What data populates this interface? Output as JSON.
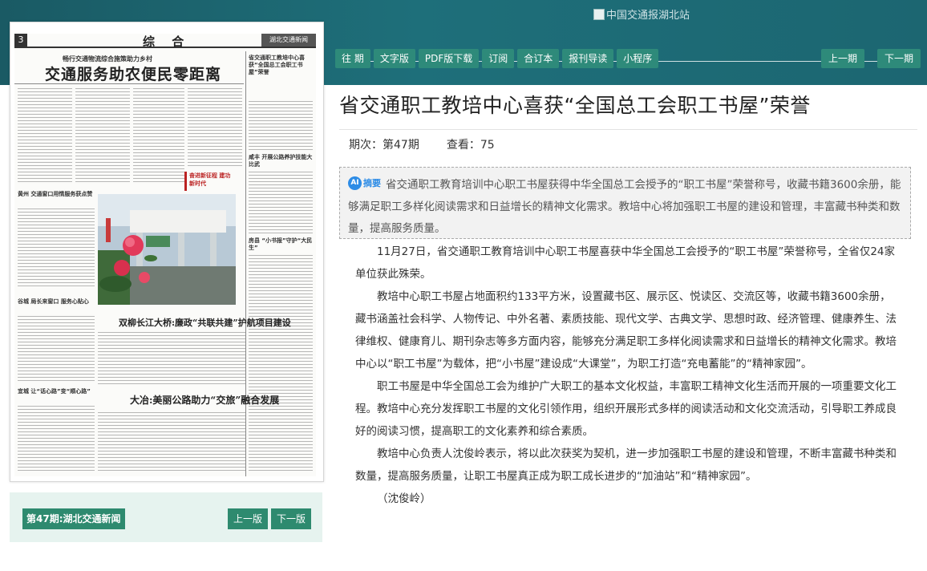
{
  "header": {
    "logo_alt": "中国交通报湖北站",
    "nav": [
      "往 期",
      "文字版",
      "PDF版下载",
      "订阅",
      "合订本",
      "报刊导读",
      "小程序"
    ],
    "prev_issue": "上一期",
    "next_issue": "下一期"
  },
  "newspaper": {
    "page_number": "3",
    "section": "综 合",
    "masthead": "湖北交通新闻",
    "headlines": {
      "kicker": "畅行交通物流综合施策助力乡村",
      "main": "交通服务助农便民零距离",
      "side_top": "省交通职工教培中心喜获“全国总工会职工书屋”荣誉",
      "photo_caption_hl": "双柳长江大桥:廉政“共联共建”护航项目建设",
      "bottom": "大冶:美丽公路助力“交旅”融合发展",
      "left1": "黄州 交通窗口用情服务获点赞",
      "left2": "谷城 局长来窗口 服务心贴心",
      "left3": "宜城 让“话心路”变“顺心路”",
      "right1": "咸丰 开展公路养护技能大比武",
      "right2": "房县 “小书报”守护“大民生”",
      "badge": "奋进新征程 建功新时代"
    }
  },
  "pager": {
    "issue_label": "第47期:湖北交通新闻",
    "prev_page": "上一版",
    "next_page": "下一版"
  },
  "article": {
    "title": "省交通职工教培中心喜获“全国总工会职工书屋”荣誉",
    "issue": "期次：第47期",
    "views": "查看：75",
    "summary_tag": "摘要",
    "summary": "省交通职工教育培训中心职工书屋获得中华全国总工会授予的“职工书屋”荣誉称号，收藏书籍3600余册，能够满足职工多样化阅读需求和日益增长的精神文化需求。教培中心将加强职工书屋的建设和管理，丰富藏书种类和数量，提高服务质量。",
    "paragraphs": [
      "11月27日，省交通职工教育培训中心职工书屋喜获中华全国总工会授予的“职工书屋”荣誉称号，全省仅24家单位获此殊荣。",
      "教培中心职工书屋占地面积约133平方米，设置藏书区、展示区、悦读区、交流区等，收藏书籍3600余册，藏书涵盖社会科学、人物传记、中外名著、素质技能、现代文学、古典文学、思想时政、经济管理、健康养生、法律维权、健康育儿、期刊杂志等多方面内容，能够充分满足职工多样化阅读需求和日益增长的精神文化需求。教培中心以“职工书屋”为载体，把“小书屋”建设成“大课堂”，为职工打造“充电蓄能”的“精神家园”。",
      "职工书屋是中华全国总工会为维护广大职工的基本文化权益，丰富职工精神文化生活而开展的一项重要文化工程。教培中心充分发挥职工书屋的文化引领作用，组织开展形式多样的阅读活动和文化交流活动，引导职工养成良好的阅读习惯，提高职工的文化素养和综合素质。",
      "教培中心负责人沈俊岭表示，将以此次获奖为契机，进一步加强职工书屋的建设和管理，不断丰富藏书种类和数量，提高服务质量，让职工书屋真正成为职工成长进步的“加油站”和“精神家园”。"
    ],
    "author": "（沈俊岭）"
  },
  "colors": {
    "header_band": "#1e6f7a",
    "nav_button": "#2e8a7a",
    "pager_bg": "#e6f3ef",
    "pager_button": "#2e8a6f",
    "ai_blue": "#2d8ce6"
  }
}
